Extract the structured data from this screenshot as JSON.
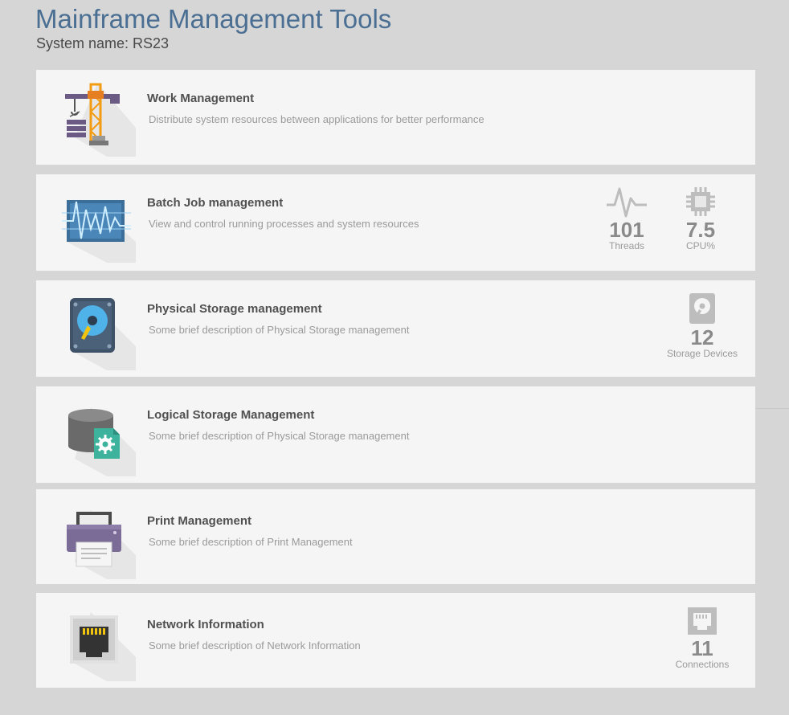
{
  "header": {
    "title": "Mainframe Management Tools",
    "system_name": "System name: RS23"
  },
  "cards": [
    {
      "title": "Work Management",
      "description": "Distribute system resources between applications for better performance",
      "icon": "crane-icon"
    },
    {
      "title": "Batch Job management",
      "description": "View and control running processes and system resources",
      "icon": "monitor-waveform-icon",
      "stats": [
        {
          "value": "101",
          "label": "Threads",
          "icon": "pulse-icon"
        },
        {
          "value": "7.5",
          "label": "CPU%",
          "icon": "cpu-chip-icon"
        }
      ]
    },
    {
      "title": "Physical Storage management",
      "description": "Some brief description of Physical Storage management",
      "icon": "hard-drive-icon",
      "stats": [
        {
          "value": "12",
          "label": "Storage Devices",
          "icon": "disk-icon"
        }
      ]
    },
    {
      "title": "Logical Storage Management",
      "description": "Some brief description of Physical Storage management",
      "icon": "database-settings-icon"
    },
    {
      "title": "Print Management",
      "description": "Some brief description of Print Management",
      "icon": "printer-icon"
    },
    {
      "title": "Network Information",
      "description": "Some brief description of Network Information",
      "icon": "ethernet-port-icon",
      "stats": [
        {
          "value": "11",
          "label": "Connections",
          "icon": "ethernet-icon"
        }
      ]
    }
  ],
  "colors": {
    "background": "#d6d6d6",
    "card": "#f5f5f5",
    "title": "#4a6f93",
    "stat": "#8a8a8a"
  }
}
